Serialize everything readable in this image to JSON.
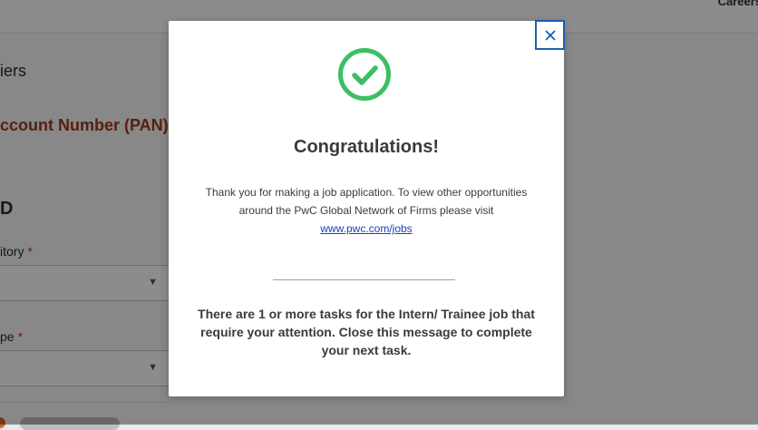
{
  "background": {
    "nav_text": "Careers",
    "section_title": "iers",
    "section_heading": "ccount Number (PAN) Re",
    "bold_letter": "D",
    "field1_label": "itory",
    "field2_label": "pe",
    "required_mark": "*",
    "dropdown_arrow": "▼"
  },
  "modal": {
    "close_icon": "×",
    "title": "Congratulations!",
    "message_text": "Thank you for making a job application. To view other opportunities around the PwC Global Network of Firms please visit",
    "link_text": "www.pwc.com/jobs",
    "tasks_message": "There are 1 or more tasks for the Intern/ Trainee job that require your attention. Close this message to complete your next task.",
    "check_color": "#3cbf63",
    "close_border_color": "#1a5fb4"
  }
}
